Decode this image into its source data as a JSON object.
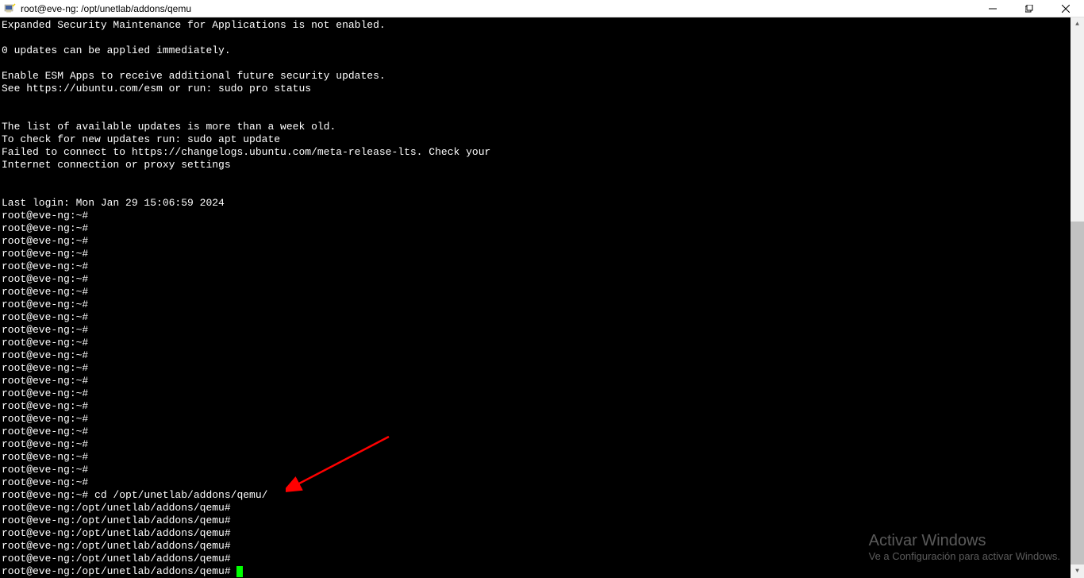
{
  "window": {
    "title": "root@eve-ng: /opt/unetlab/addons/qemu"
  },
  "terminal": {
    "lines": [
      "Expanded Security Maintenance for Applications is not enabled.",
      "",
      "0 updates can be applied immediately.",
      "",
      "Enable ESM Apps to receive additional future security updates.",
      "See https://ubuntu.com/esm or run: sudo pro status",
      "",
      "",
      "The list of available updates is more than a week old.",
      "To check for new updates run: sudo apt update",
      "Failed to connect to https://changelogs.ubuntu.com/meta-release-lts. Check your",
      "Internet connection or proxy settings",
      "",
      "",
      "Last login: Mon Jan 29 15:06:59 2024",
      "root@eve-ng:~#",
      "root@eve-ng:~#",
      "root@eve-ng:~#",
      "root@eve-ng:~#",
      "root@eve-ng:~#",
      "root@eve-ng:~#",
      "root@eve-ng:~#",
      "root@eve-ng:~#",
      "root@eve-ng:~#",
      "root@eve-ng:~#",
      "root@eve-ng:~#",
      "root@eve-ng:~#",
      "root@eve-ng:~#",
      "root@eve-ng:~#",
      "root@eve-ng:~#",
      "root@eve-ng:~#",
      "root@eve-ng:~#",
      "root@eve-ng:~#",
      "root@eve-ng:~#",
      "root@eve-ng:~#",
      "root@eve-ng:~#",
      "root@eve-ng:~#",
      "root@eve-ng:~# cd /opt/unetlab/addons/qemu/",
      "root@eve-ng:/opt/unetlab/addons/qemu#",
      "root@eve-ng:/opt/unetlab/addons/qemu#",
      "root@eve-ng:/opt/unetlab/addons/qemu#",
      "root@eve-ng:/opt/unetlab/addons/qemu#",
      "root@eve-ng:/opt/unetlab/addons/qemu#",
      "root@eve-ng:/opt/unetlab/addons/qemu# "
    ]
  },
  "watermark": {
    "title": "Activar Windows",
    "subtitle": "Ve a Configuración para activar Windows."
  }
}
